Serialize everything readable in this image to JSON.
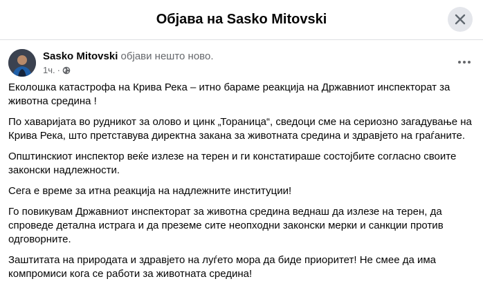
{
  "dialog": {
    "title": "Објава на Sasko Mitovski",
    "close_icon": "close-icon"
  },
  "post": {
    "author": "Sasko Mitovski",
    "action": " објави нешто ново.",
    "time": "1ч.",
    "separator": "·",
    "audience_icon": "globe-icon",
    "more_icon": "more-horizontal-icon",
    "paragraphs": [
      "Еколошка катастрофа на Крива Река – итно бараме реакција на Државниот инспекторат за животна средина !",
      "По хаваријата во рудникот за олово и цинк „Тораница“, сведоци сме на сериозно загадување на Крива Река, што претставува директна закана за животната средина и здравјето на граѓаните.",
      "Општинскиот инспектор веќе излезе на терен и ги констатираше состојбите согласно своите законски надлежности.",
      "Сега е време за итна реакција на надлежните институции!",
      "Го повикувам Државниот инспекторат за животна средина веднаш да излезе на терен, да спроведе детална истрага и да преземе сите неопходни законски мерки и санкции против одговорните.",
      "Заштитата на природата и здравјето на луѓето мора да биде приоритет! Не смее да има компромиси кога се работи за животната средина!"
    ]
  }
}
